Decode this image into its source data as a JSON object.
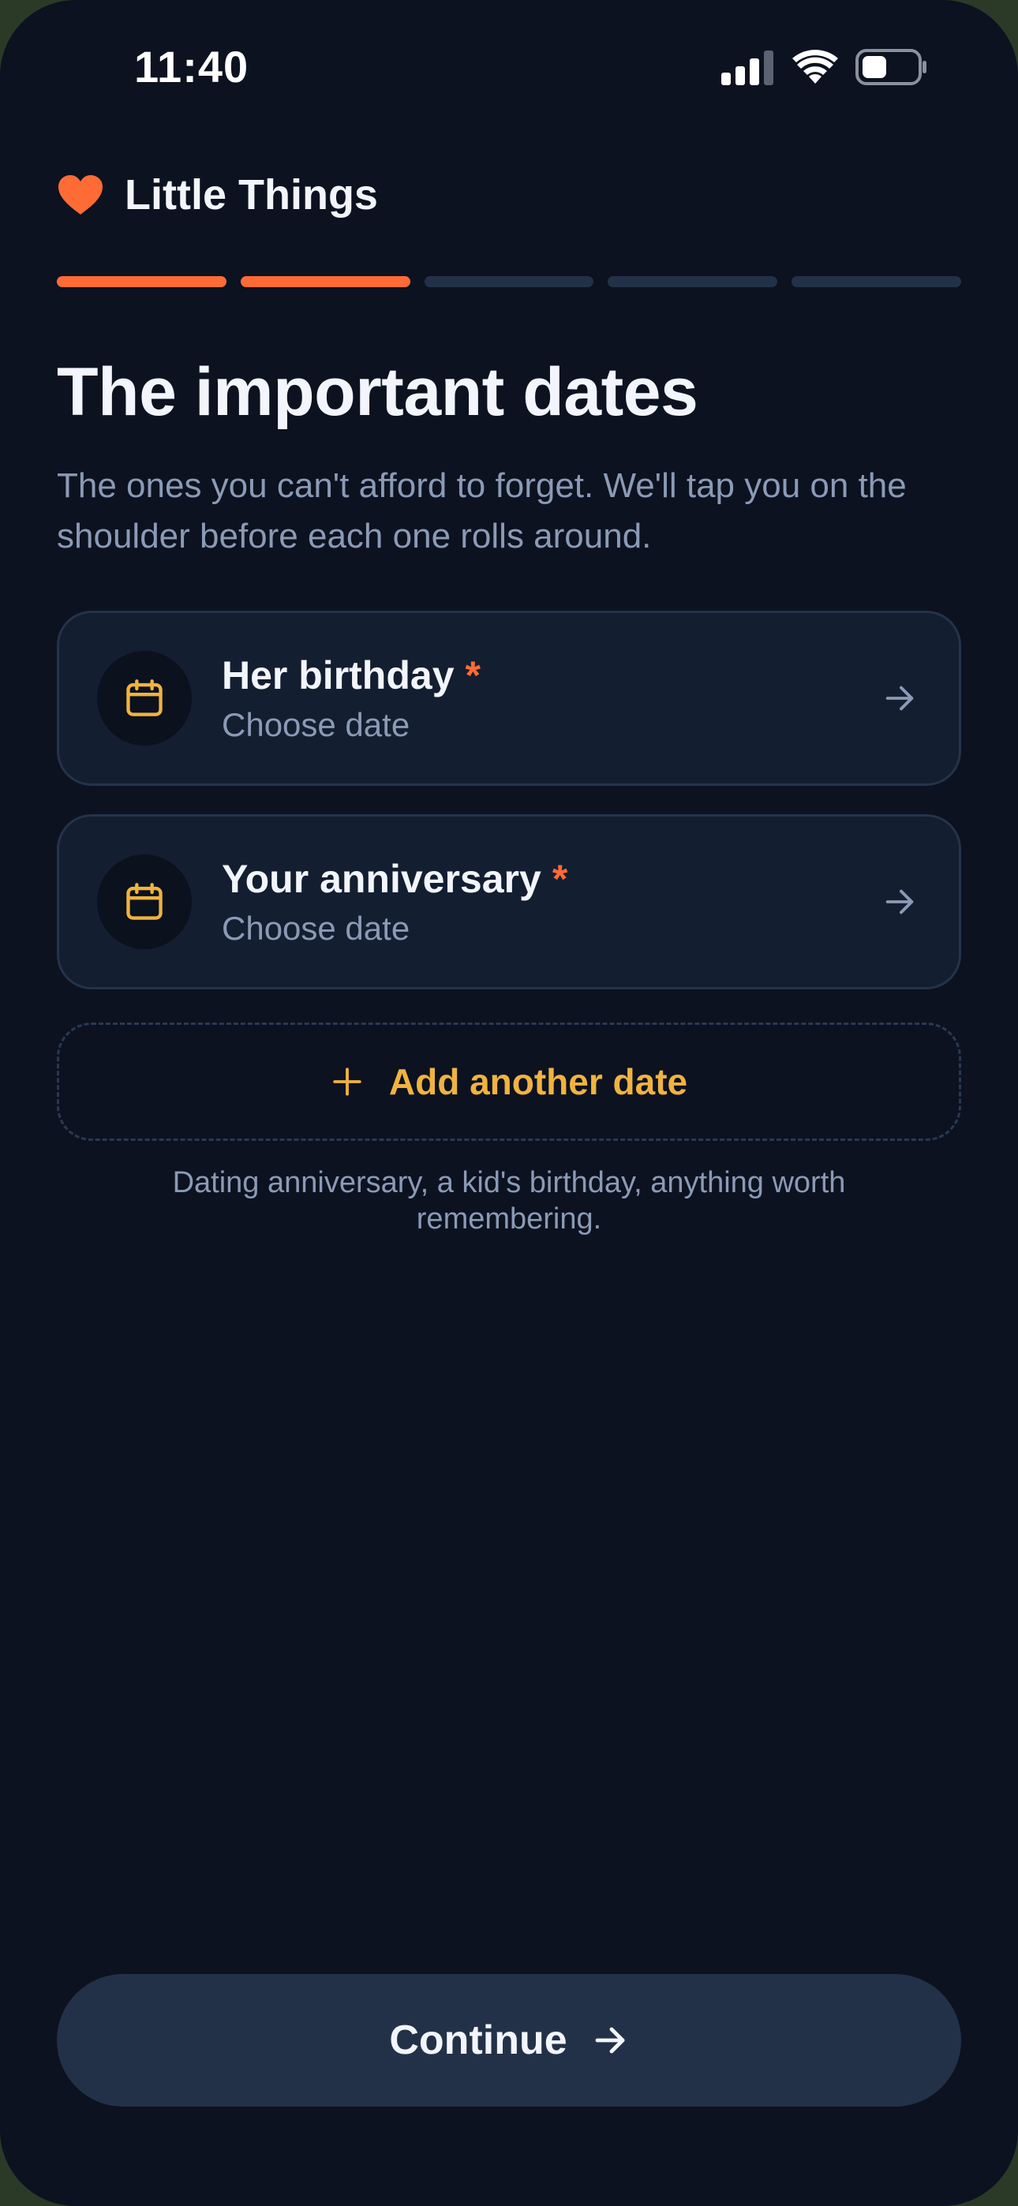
{
  "status_bar": {
    "time": "11:40"
  },
  "brand": {
    "name": "Little Things",
    "icon": "heart-icon",
    "color": "#ff6b35"
  },
  "progress": {
    "total_steps": 5,
    "completed_steps": 2,
    "active_color": "#ff6b35",
    "inactive_color": "#233148"
  },
  "page": {
    "title": "The important dates",
    "subtitle": "The ones you can't afford to forget. We'll tap you on the shoulder before each one rolls around."
  },
  "dates": [
    {
      "title": "Her birthday",
      "required_mark": "*",
      "value_placeholder": "Choose date",
      "icon": "calendar-icon"
    },
    {
      "title": "Your anniversary",
      "required_mark": "*",
      "value_placeholder": "Choose date",
      "icon": "calendar-icon"
    }
  ],
  "add_date": {
    "label": "Add another date",
    "icon": "plus-icon",
    "helper": "Dating anniversary, a kid's birthday, anything worth remembering."
  },
  "footer": {
    "continue_label": "Continue",
    "icon": "arrow-right-icon"
  },
  "colors": {
    "background": "#0c1220",
    "card": "#141e31",
    "accent": "#ff6b35",
    "gold": "#f0b340",
    "muted_text": "#8b9ab5"
  }
}
